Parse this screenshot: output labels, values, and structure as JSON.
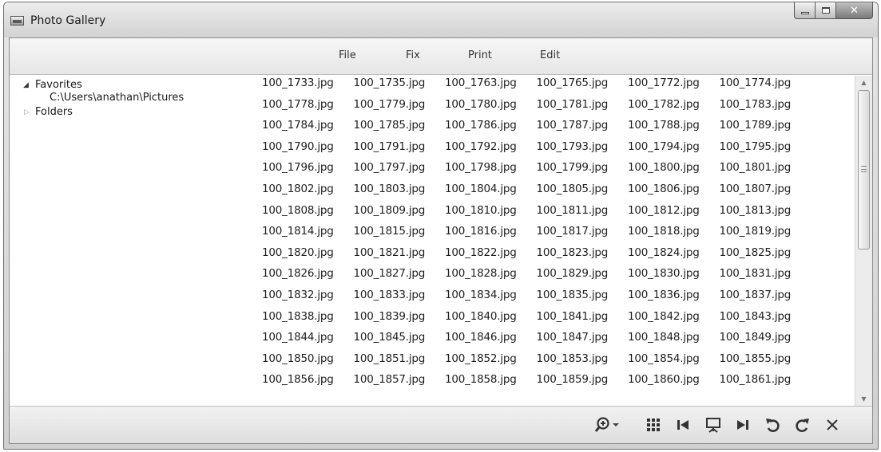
{
  "window": {
    "title": "Photo Gallery"
  },
  "menu": [
    {
      "label": "File"
    },
    {
      "label": "Fix"
    },
    {
      "label": "Print"
    },
    {
      "label": "Edit"
    }
  ],
  "tree": {
    "favorites": {
      "label": "Favorites",
      "expanded": true
    },
    "favorite_path": "C:\\Users\\anathan\\Pictures",
    "folders": {
      "label": "Folders",
      "expanded": false
    }
  },
  "files": [
    [
      "100_1733.jpg",
      "100_1735.jpg",
      "100_1763.jpg",
      "100_1765.jpg",
      "100_1772.jpg",
      "100_1774.jpg"
    ],
    [
      "100_1778.jpg",
      "100_1779.jpg",
      "100_1780.jpg",
      "100_1781.jpg",
      "100_1782.jpg",
      "100_1783.jpg"
    ],
    [
      "100_1784.jpg",
      "100_1785.jpg",
      "100_1786.jpg",
      "100_1787.jpg",
      "100_1788.jpg",
      "100_1789.jpg"
    ],
    [
      "100_1790.jpg",
      "100_1791.jpg",
      "100_1792.jpg",
      "100_1793.jpg",
      "100_1794.jpg",
      "100_1795.jpg"
    ],
    [
      "100_1796.jpg",
      "100_1797.jpg",
      "100_1798.jpg",
      "100_1799.jpg",
      "100_1800.jpg",
      "100_1801.jpg"
    ],
    [
      "100_1802.jpg",
      "100_1803.jpg",
      "100_1804.jpg",
      "100_1805.jpg",
      "100_1806.jpg",
      "100_1807.jpg"
    ],
    [
      "100_1808.jpg",
      "100_1809.jpg",
      "100_1810.jpg",
      "100_1811.jpg",
      "100_1812.jpg",
      "100_1813.jpg"
    ],
    [
      "100_1814.jpg",
      "100_1815.jpg",
      "100_1816.jpg",
      "100_1817.jpg",
      "100_1818.jpg",
      "100_1819.jpg"
    ],
    [
      "100_1820.jpg",
      "100_1821.jpg",
      "100_1822.jpg",
      "100_1823.jpg",
      "100_1824.jpg",
      "100_1825.jpg"
    ],
    [
      "100_1826.jpg",
      "100_1827.jpg",
      "100_1828.jpg",
      "100_1829.jpg",
      "100_1830.jpg",
      "100_1831.jpg"
    ],
    [
      "100_1832.jpg",
      "100_1833.jpg",
      "100_1834.jpg",
      "100_1835.jpg",
      "100_1836.jpg",
      "100_1837.jpg"
    ],
    [
      "100_1838.jpg",
      "100_1839.jpg",
      "100_1840.jpg",
      "100_1841.jpg",
      "100_1842.jpg",
      "100_1843.jpg"
    ],
    [
      "100_1844.jpg",
      "100_1845.jpg",
      "100_1846.jpg",
      "100_1847.jpg",
      "100_1848.jpg",
      "100_1849.jpg"
    ],
    [
      "100_1850.jpg",
      "100_1851.jpg",
      "100_1852.jpg",
      "100_1853.jpg",
      "100_1854.jpg",
      "100_1855.jpg"
    ],
    [
      "100_1856.jpg",
      "100_1857.jpg",
      "100_1858.jpg",
      "100_1859.jpg",
      "100_1860.jpg",
      "100_1861.jpg"
    ]
  ],
  "toolbar": [
    {
      "icon": "zoom-icon"
    },
    {
      "icon": "grid-view-icon"
    },
    {
      "icon": "previous-icon"
    },
    {
      "icon": "slideshow-icon"
    },
    {
      "icon": "next-icon"
    },
    {
      "icon": "rotate-left-icon"
    },
    {
      "icon": "rotate-right-icon"
    },
    {
      "icon": "delete-icon"
    }
  ],
  "colors": {
    "window_frame": "#d6d6d6",
    "menubar": "#eeeeee",
    "content": "#ffffff",
    "text": "#1e1e1e"
  }
}
